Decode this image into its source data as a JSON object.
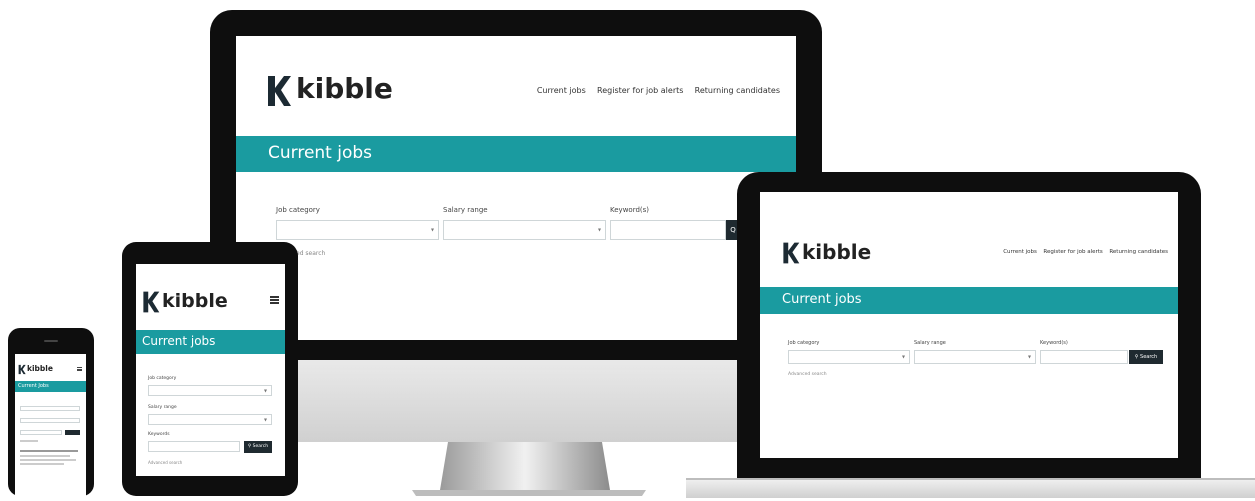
{
  "brand": {
    "name": "kibble"
  },
  "nav": {
    "items": [
      "Current jobs",
      "Register for job alerts",
      "Returning candidates"
    ]
  },
  "page": {
    "title": "Current jobs",
    "short_title": "Current Jobs"
  },
  "form": {
    "job_category_label": "Job category",
    "salary_range_label": "Salary range",
    "keywords_label": "Keyword(s)",
    "keywords_label_short": "Keywords",
    "search_button": "Search",
    "advanced_search_link": "Advanced search",
    "advanced_search_fragment": "ed search"
  },
  "icons": {
    "search": "search-icon",
    "menu": "hamburger-menu-icon",
    "dropdown": "chevron-down-icon",
    "logo": "kibble-k-logo-icon"
  },
  "colors": {
    "accent": "#1a9ba0",
    "device_frame": "#111111",
    "button": "#1f2a30"
  }
}
